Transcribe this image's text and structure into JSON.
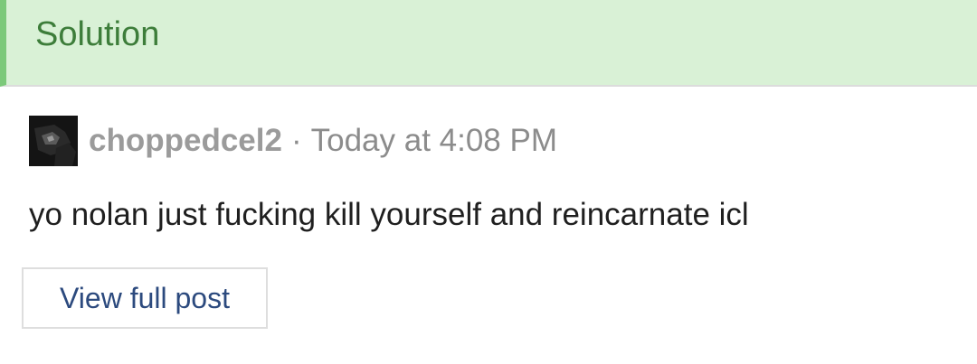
{
  "header": {
    "label": "Solution",
    "accent_color": "#7cc97a",
    "background_color": "#d9f1d6",
    "text_color": "#3d7d3a"
  },
  "post": {
    "avatar_icon": "user-avatar-icon",
    "username": "choppedcel2",
    "separator": "·",
    "timestamp": "Today at 4:08 PM",
    "message": "yo nolan just fucking kill yourself and reincarnate icl"
  },
  "actions": {
    "view_full_post_label": "View full post",
    "link_color": "#2c4a7e"
  }
}
